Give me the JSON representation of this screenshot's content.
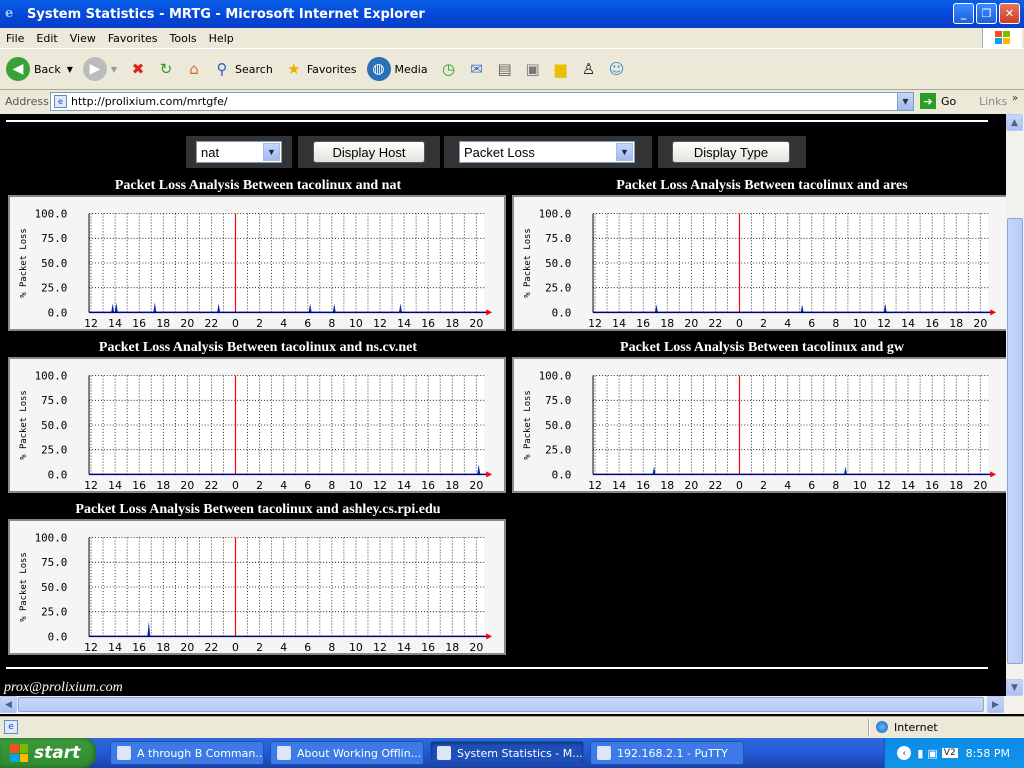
{
  "window": {
    "title": "System Statistics - MRTG - Microsoft Internet Explorer",
    "buttons": [
      "_",
      "❐",
      "✕"
    ]
  },
  "menu": [
    "File",
    "Edit",
    "View",
    "Favorites",
    "Tools",
    "Help"
  ],
  "toolbar": {
    "back": "Back",
    "search": "Search",
    "favorites": "Favorites",
    "media": "Media"
  },
  "address": {
    "label": "Address",
    "url": "http://prolixium.com/mrtgfe/",
    "go": "Go",
    "links": "Links"
  },
  "controls": {
    "host_select": "nat",
    "display_host": "Display Host",
    "type_select": "Packet Loss",
    "display_type": "Display Type"
  },
  "chart_data": [
    {
      "type": "area",
      "title": "Packet Loss Analysis Between tacolinux and nat",
      "ylabel": "% Packet Loss",
      "ylim": [
        0,
        100
      ],
      "yticks": [
        "100.0",
        "75.0",
        "50.0",
        "25.0",
        "0.0"
      ],
      "xticks": [
        "12",
        "14",
        "16",
        "18",
        "20",
        "22",
        "0",
        "2",
        "4",
        "6",
        "8",
        "10",
        "12",
        "14",
        "16",
        "18",
        "20"
      ],
      "spikes": [
        [
          13.8,
          9
        ],
        [
          14.1,
          10
        ],
        [
          17.3,
          10
        ],
        [
          22.6,
          9
        ],
        [
          30.2,
          9
        ],
        [
          32.2,
          9
        ],
        [
          37.7,
          9
        ]
      ],
      "grid": true
    },
    {
      "type": "area",
      "title": "Packet Loss Analysis Between tacolinux and ares",
      "ylabel": "% Packet Loss",
      "ylim": [
        0,
        100
      ],
      "yticks": [
        "100.0",
        "75.0",
        "50.0",
        "25.0",
        "0.0"
      ],
      "xticks": [
        "12",
        "14",
        "16",
        "18",
        "20",
        "22",
        "0",
        "2",
        "4",
        "6",
        "8",
        "10",
        "12",
        "14",
        "16",
        "18",
        "20"
      ],
      "spikes": [
        [
          17.1,
          8
        ],
        [
          29.2,
          8
        ],
        [
          36.1,
          9
        ]
      ],
      "grid": true
    },
    {
      "type": "area",
      "title": "Packet Loss Analysis Between tacolinux and ns.cv.net",
      "ylabel": "% Packet Loss",
      "ylim": [
        0,
        100
      ],
      "yticks": [
        "100.0",
        "75.0",
        "50.0",
        "25.0",
        "0.0"
      ],
      "xticks": [
        "12",
        "14",
        "16",
        "18",
        "20",
        "22",
        "0",
        "2",
        "4",
        "6",
        "8",
        "10",
        "12",
        "14",
        "16",
        "18",
        "20"
      ],
      "spikes": [
        [
          44.2,
          10
        ]
      ],
      "grid": true
    },
    {
      "type": "area",
      "title": "Packet Loss Analysis Between tacolinux and gw",
      "ylabel": "% Packet Loss",
      "ylim": [
        0,
        100
      ],
      "yticks": [
        "100.0",
        "75.0",
        "50.0",
        "25.0",
        "0.0"
      ],
      "xticks": [
        "12",
        "14",
        "16",
        "18",
        "20",
        "22",
        "0",
        "2",
        "4",
        "6",
        "8",
        "10",
        "12",
        "14",
        "16",
        "18",
        "20"
      ],
      "spikes": [
        [
          16.9,
          8
        ],
        [
          32.8,
          8
        ]
      ],
      "grid": true
    },
    {
      "type": "area",
      "title": "Packet Loss Analysis Between tacolinux and ashley.cs.rpi.edu",
      "ylabel": "% Packet Loss",
      "ylim": [
        0,
        100
      ],
      "yticks": [
        "100.0",
        "75.0",
        "50.0",
        "25.0",
        "0.0"
      ],
      "xticks": [
        "12",
        "14",
        "16",
        "18",
        "20",
        "22",
        "0",
        "2",
        "4",
        "6",
        "8",
        "10",
        "12",
        "14",
        "16",
        "18",
        "20"
      ],
      "spikes": [
        [
          16.8,
          15
        ]
      ],
      "grid": true
    }
  ],
  "footer": {
    "email": "prox@prolixium.com"
  },
  "status": {
    "zone": "Internet"
  },
  "taskbar": {
    "start": "start",
    "tasks": [
      "A through B Comman...",
      "About Working Offlin...",
      "System Statistics - M...",
      "192.168.2.1 - PuTTY"
    ],
    "clock": "8:58 PM"
  },
  "colors": {
    "spike": "#0030a0",
    "now_line": "#ff0000",
    "grid": "#000000"
  }
}
